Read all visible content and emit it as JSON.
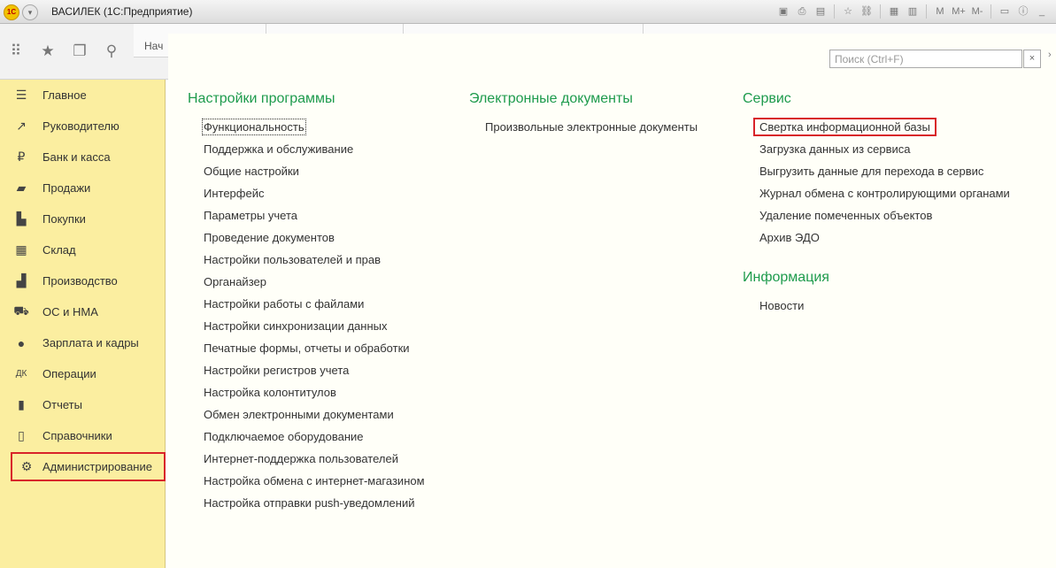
{
  "window": {
    "logo": "1С",
    "title": "ВАСИЛЕК  (1С:Предприятие)",
    "toolbar_buttons": [
      "M",
      "M+",
      "M-"
    ]
  },
  "toolbar": {
    "start_tab_label": "Нач"
  },
  "sidebar": {
    "items": [
      {
        "label": "Главное",
        "icon": "list-icon"
      },
      {
        "label": "Руководителю",
        "icon": "trend-icon"
      },
      {
        "label": "Банк и касса",
        "icon": "ruble-icon"
      },
      {
        "label": "Продажи",
        "icon": "bag-icon"
      },
      {
        "label": "Покупки",
        "icon": "cart-icon"
      },
      {
        "label": "Склад",
        "icon": "warehouse-icon"
      },
      {
        "label": "Производство",
        "icon": "factory-icon"
      },
      {
        "label": "ОС и НМА",
        "icon": "truck-icon"
      },
      {
        "label": "Зарплата и кадры",
        "icon": "person-icon"
      },
      {
        "label": "Операции",
        "icon": "debit-credit-icon"
      },
      {
        "label": "Отчеты",
        "icon": "bar-chart-icon"
      },
      {
        "label": "Справочники",
        "icon": "book-icon"
      },
      {
        "label": "Администрирование",
        "icon": "gear-icon"
      }
    ]
  },
  "search": {
    "placeholder": "Поиск (Ctrl+F)",
    "clear": "×"
  },
  "sections": {
    "settings": {
      "title": "Настройки программы",
      "items": [
        "Функциональность",
        "Поддержка и обслуживание",
        "Общие настройки",
        "Интерфейс",
        "Параметры учета",
        "Проведение документов",
        "Настройки пользователей и прав",
        "Органайзер",
        "Настройки работы с файлами",
        "Настройки синхронизации данных",
        "Печатные формы, отчеты и обработки",
        "Настройки регистров учета",
        "Настройка колонтитулов",
        "Обмен электронными документами",
        "Подключаемое оборудование",
        "Интернет-поддержка пользователей",
        "Настройка обмена с интернет-магазином",
        "Настройка отправки push-уведомлений"
      ]
    },
    "edocs": {
      "title": "Электронные документы",
      "items": [
        "Произвольные электронные документы"
      ]
    },
    "service": {
      "title": "Сервис",
      "items": [
        "Свертка информационной базы",
        "Загрузка данных из сервиса",
        "Выгрузить данные для перехода в сервис",
        "Журнал обмена с контролирующими органами",
        "Удаление помеченных объектов",
        "Архив ЭДО"
      ]
    },
    "info": {
      "title": "Информация",
      "items": [
        "Новости"
      ]
    }
  }
}
